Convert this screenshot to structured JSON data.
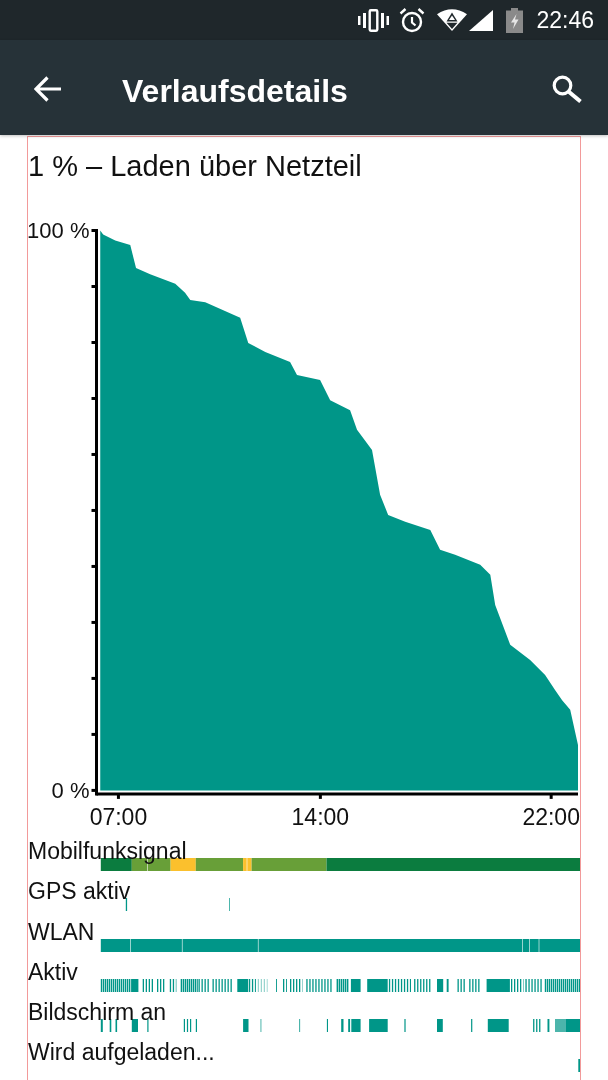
{
  "status_bar": {
    "time": "22:46"
  },
  "app_bar": {
    "title": "Verlaufsdetails"
  },
  "history": {
    "summary": "1 % – Laden über Netzteil",
    "chart_data": {
      "type": "area",
      "x": [
        6.37,
        6.47,
        6.89,
        7.41,
        7.61,
        8.1,
        8.97,
        9.31,
        9.49,
        10.01,
        11.22,
        11.5,
        12.09,
        12.95,
        13.19,
        13.99,
        14.34,
        15.03,
        15.27,
        15.79,
        16.07,
        16.35,
        16.94,
        17.81,
        18.15,
        18.67,
        19.54,
        19.89,
        20.06,
        20.58,
        21.27,
        21.79,
        22.14,
        22.38,
        22.66,
        22.93
      ],
      "values": [
        100,
        99.3,
        98.2,
        97.4,
        93.3,
        92.2,
        90.5,
        88.9,
        87.6,
        87.2,
        84.4,
        79.9,
        78.3,
        76.5,
        74.2,
        73.3,
        69.7,
        67.9,
        64.4,
        60.8,
        52.8,
        49.2,
        48.0,
        46.5,
        43.0,
        42.1,
        40.3,
        38.5,
        33.1,
        26.0,
        23.3,
        20.6,
        17.9,
        16.1,
        14.4,
        8.1
      ],
      "xlim": [
        6.24,
        22.93
      ],
      "ylim": [
        0,
        100
      ],
      "xticks": [
        {
          "value": 7,
          "label": "07:00"
        },
        {
          "value": 14,
          "label": "14:00"
        },
        {
          "value": 22,
          "label": "22:00"
        }
      ],
      "yticks": [
        {
          "value": 0,
          "label": "0 %"
        },
        {
          "value": 100,
          "label": "100 %"
        }
      ]
    },
    "lanes": [
      {
        "label": "Mobilfunksignal",
        "kind": "signal"
      },
      {
        "label": "GPS aktiv",
        "kind": "gps"
      },
      {
        "label": "WLAN",
        "kind": "wlan"
      },
      {
        "label": "Aktiv",
        "kind": "awake"
      },
      {
        "label": "Bildschirm an",
        "kind": "screen"
      },
      {
        "label": "Wird aufgeladen...",
        "kind": "charging"
      }
    ]
  }
}
